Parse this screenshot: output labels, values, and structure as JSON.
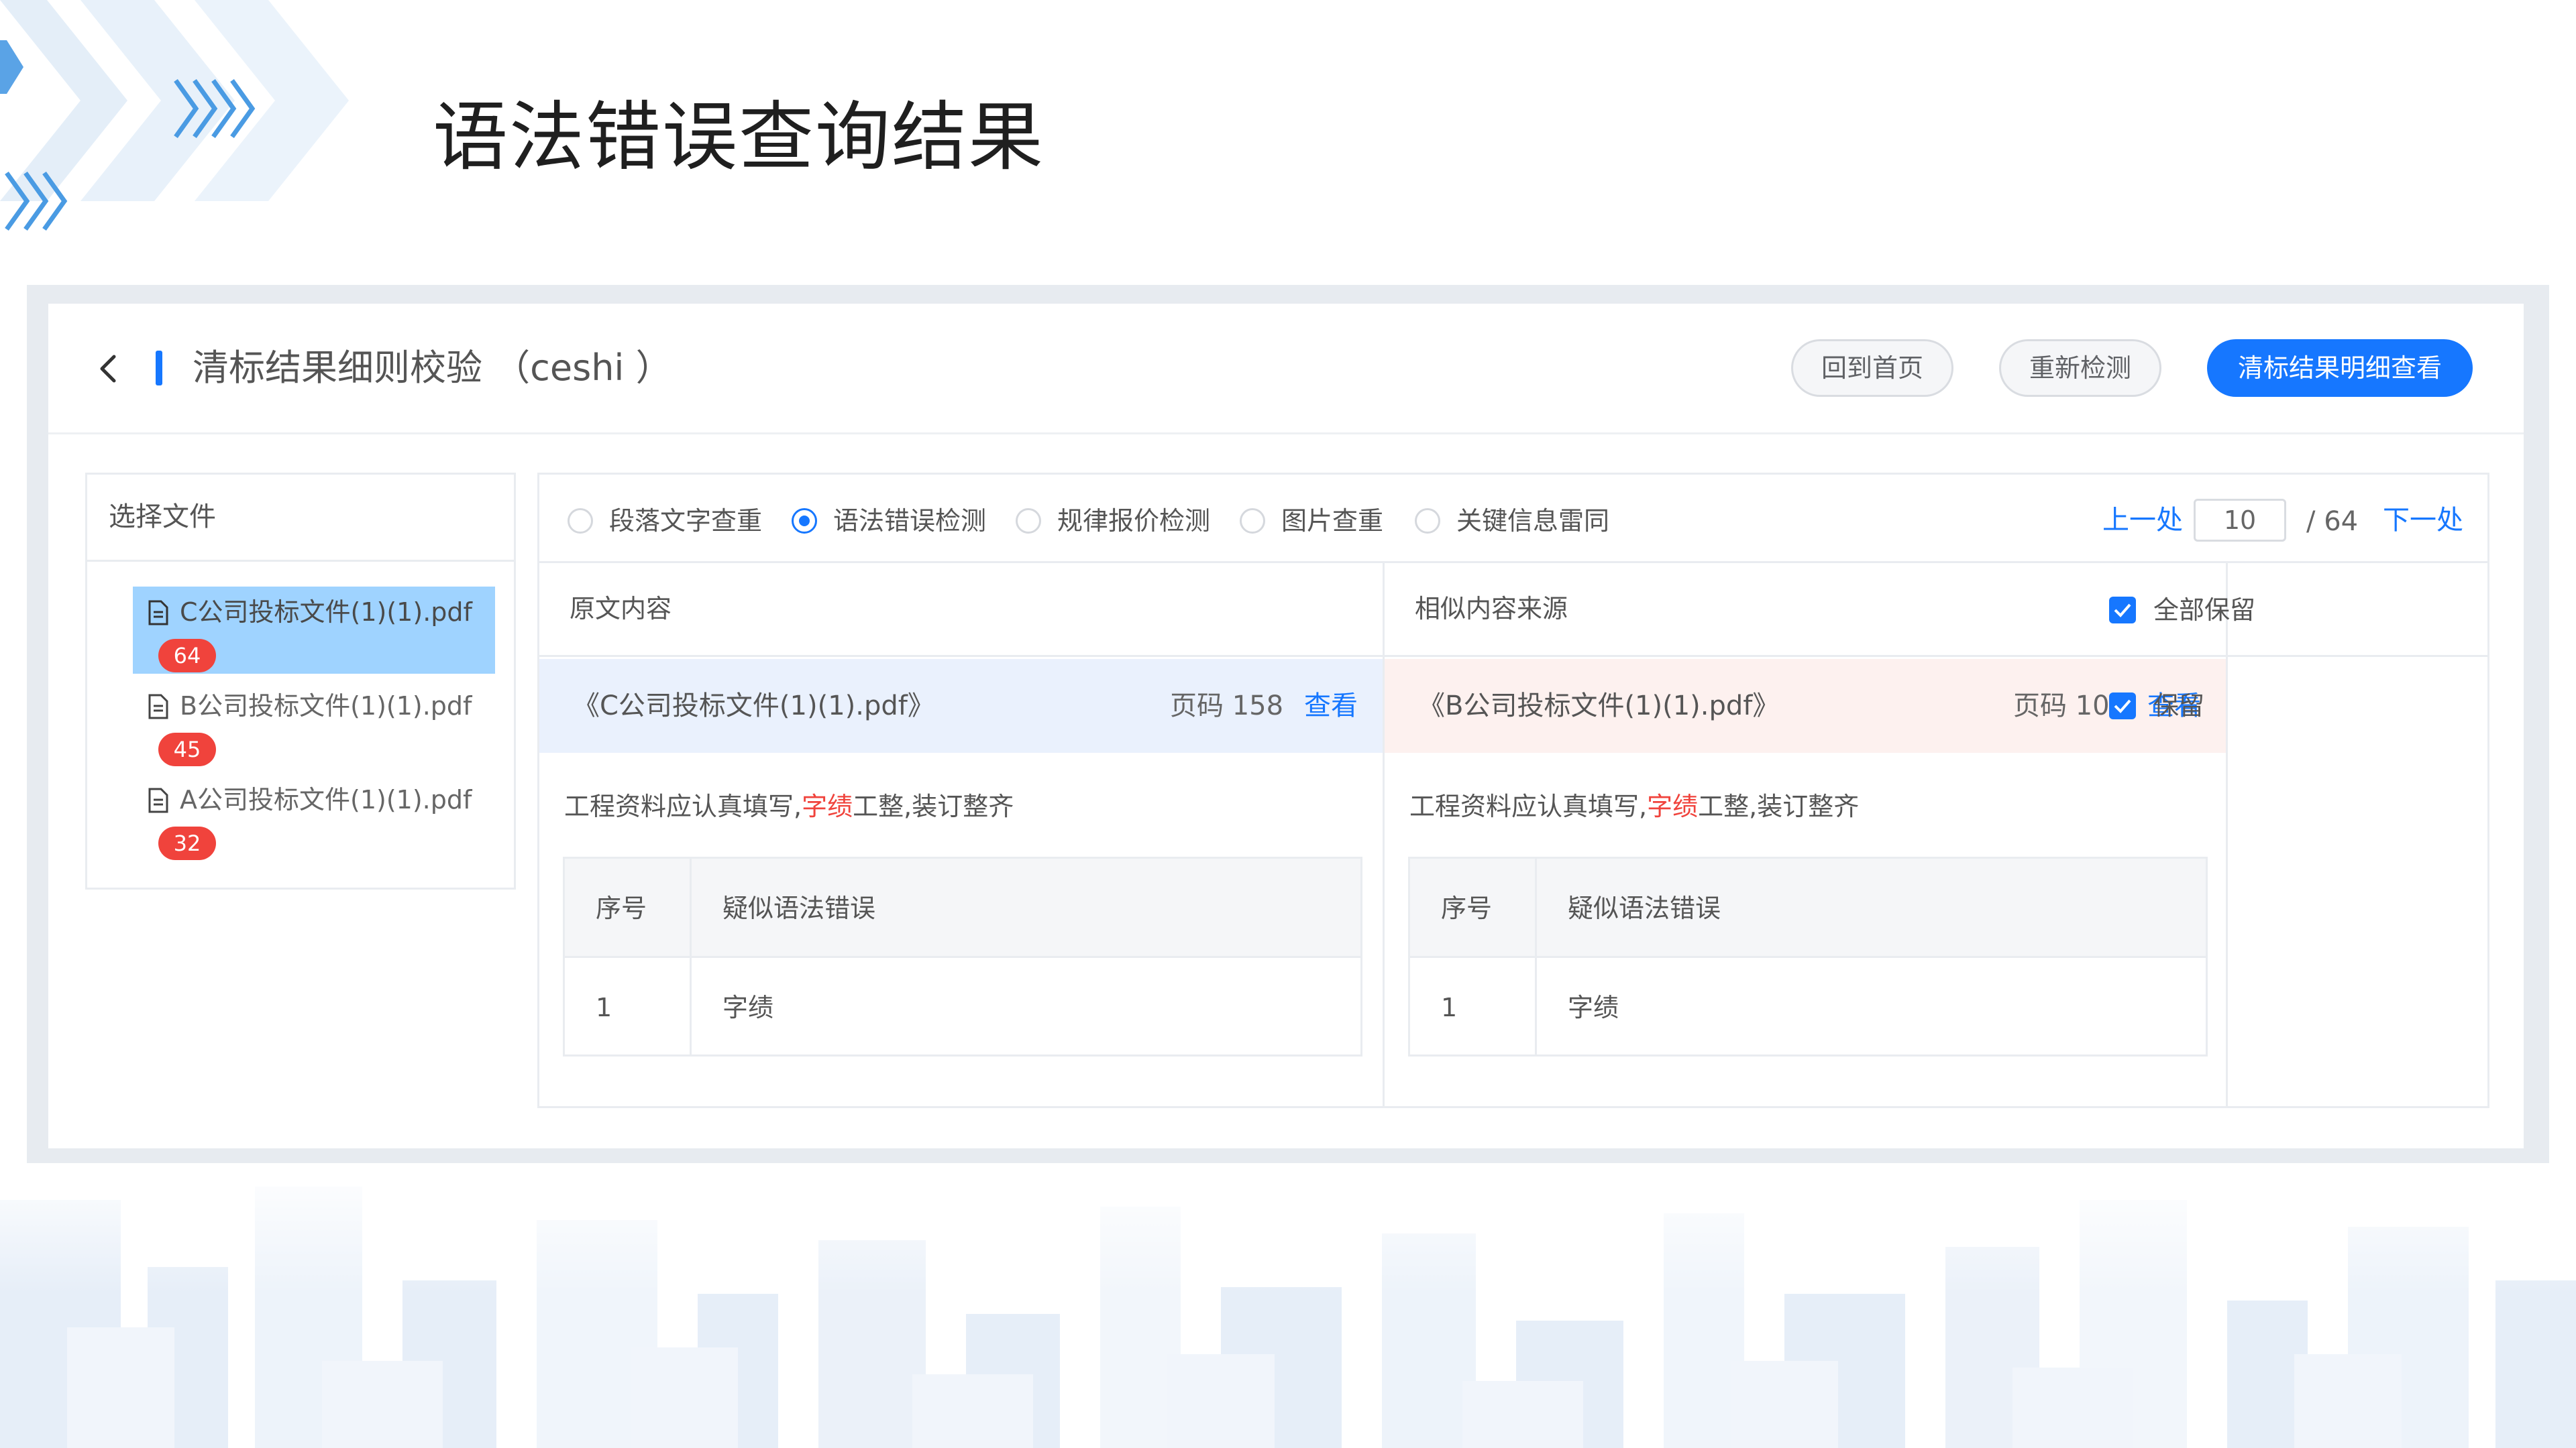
{
  "slide_title": "语法错误查询结果",
  "header": {
    "title": "清标结果细则校验 （ceshi ）",
    "btn_home": "回到首页",
    "btn_recheck": "重新检测",
    "btn_detail": "清标结果明细查看"
  },
  "colors": {
    "primary": "#1677ff",
    "badge": "#f0433c",
    "active_file": "#9fd3ff",
    "left_source_bg": "#eaf1fd",
    "right_source_bg": "#fdf1ef"
  },
  "file_panel": {
    "heading": "选择文件",
    "files": [
      {
        "name": "C公司投标文件(1)(1).pdf",
        "count": "64",
        "active": true
      },
      {
        "name": "B公司投标文件(1)(1).pdf",
        "count": "45",
        "active": false
      },
      {
        "name": "A公司投标文件(1)(1).pdf",
        "count": "32",
        "active": false
      }
    ]
  },
  "tabs": [
    {
      "label": "段落文字查重",
      "checked": false
    },
    {
      "label": "语法错误检测",
      "checked": true
    },
    {
      "label": "规律报价检测",
      "checked": false
    },
    {
      "label": "图片查重",
      "checked": false
    },
    {
      "label": "关键信息雷同",
      "checked": false
    }
  ],
  "pager": {
    "prev": "上一处",
    "current": "10",
    "total": "/  64",
    "next": "下一处"
  },
  "columns": {
    "original": "原文内容",
    "similar": "相似内容来源",
    "keep_all": "全部保留",
    "keep": "保留"
  },
  "original": {
    "file": "《C公司投标文件(1)(1).pdf》",
    "page": "页码  158",
    "view": "查看",
    "text_before": "工程资料应认真填写,",
    "text_error": "字绩",
    "text_after": "工整,装订整齐",
    "table_head_no": "序号",
    "table_head_err": "疑似语法错误",
    "rows": [
      {
        "no": "1",
        "err": "字绩"
      }
    ]
  },
  "similar": {
    "file": "《B公司投标文件(1)(1).pdf》",
    "page": "页码  105",
    "view": "查看",
    "text_before": "工程资料应认真填写,",
    "text_error": "字绩",
    "text_after": "工整,装订整齐",
    "table_head_no": "序号",
    "table_head_err": "疑似语法错误",
    "rows": [
      {
        "no": "1",
        "err": "字绩"
      }
    ]
  }
}
